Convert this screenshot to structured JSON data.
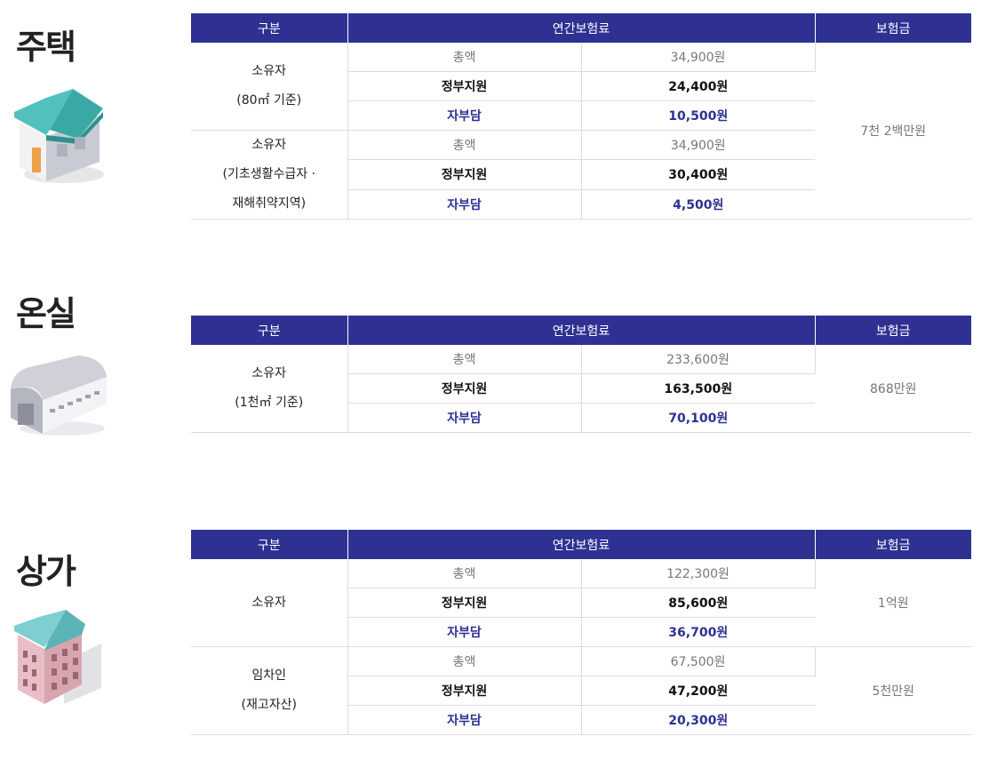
{
  "headers": {
    "col1": "구분",
    "col2": "연간보험료",
    "col3": "보험금"
  },
  "row_labels": {
    "total": "총액",
    "gov": "정부지원",
    "self": "자부담"
  },
  "sections": [
    {
      "title": "주택",
      "icon": "house-icon",
      "groups": [
        {
          "label_lines": [
            "소유자",
            "(80㎡ 기준)"
          ],
          "total": "34,900원",
          "gov": "24,400원",
          "self": "10,500원"
        },
        {
          "label_lines": [
            "소유자",
            "(기초생활수급자 ·",
            "재해취약지역)"
          ],
          "total": "34,900원",
          "gov": "30,400원",
          "self": "4,500원"
        }
      ],
      "benefits": [
        "7천 2백만원"
      ]
    },
    {
      "title": "온실",
      "icon": "greenhouse-icon",
      "groups": [
        {
          "label_lines": [
            "소유자",
            "(1천㎡ 기준)"
          ],
          "total": "233,600원",
          "gov": "163,500원",
          "self": "70,100원"
        }
      ],
      "benefits": [
        "868만원"
      ]
    },
    {
      "title": "상가",
      "icon": "building-icon",
      "groups": [
        {
          "label_lines": [
            "소유자"
          ],
          "total": "122,300원",
          "gov": "85,600원",
          "self": "36,700원"
        },
        {
          "label_lines": [
            "임차인",
            "(재고자산)"
          ],
          "total": "67,500원",
          "gov": "47,200원",
          "self": "20,300원"
        }
      ],
      "benefits": [
        "1억원",
        "5천만원"
      ]
    }
  ],
  "colors": {
    "header_bg": "#2e3192",
    "self_text": "#2e3192"
  }
}
